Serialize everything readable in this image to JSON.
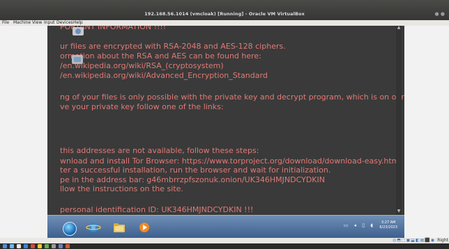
{
  "window": {
    "title": "192.168.56.1014 (vmcloak) [Running] - Oracle VM VirtualBox"
  },
  "menu": [
    "File",
    "Machine",
    "View",
    "Input",
    "Devices",
    "Help"
  ],
  "ransom_note": {
    "lines": [
      "PORTANT INFORMATION !!!!",
      "ur files are encrypted with RSA-2048 and AES-128 ciphers.",
      "ormation about the RSA and AES can be found here:",
      "/en.wikipedia.org/wiki/RSA_(cryptosystem)",
      "/en.wikipedia.org/wiki/Advanced_Encryption_Standard",
      "",
      "ng of your files is only possible with the private key and decrypt program, which is on our secret",
      "ve your private key follow one of the links:",
      "",
      "",
      "this addresses are not available, follow these steps:",
      "wnload and install Tor Browser: https://www.torproject.org/download/download-easy.html",
      "ter a successful installation, run the browser and wait for initialization.",
      "pe in the address bar: g46mbrrzpfszonuk.onion/UK346HMJNDCYDKIN",
      "llow the instructions on the site.",
      "",
      "personal identification ID: UK346HMJNDCYDKIN !!!",
      "*-~+$=|.=",
      "=-$",
      "~|*~|=~$--$"
    ],
    "color": "#e07a75"
  },
  "guest_taskbar": {
    "time": "3:27 AM",
    "date": "6/23/2023"
  },
  "status_bar": {
    "host_key": "Right"
  },
  "icons": {
    "start": "windows-start-orb-icon",
    "ie": "internet-explorer-icon",
    "explorer": "file-explorer-icon",
    "media": "media-player-icon"
  }
}
